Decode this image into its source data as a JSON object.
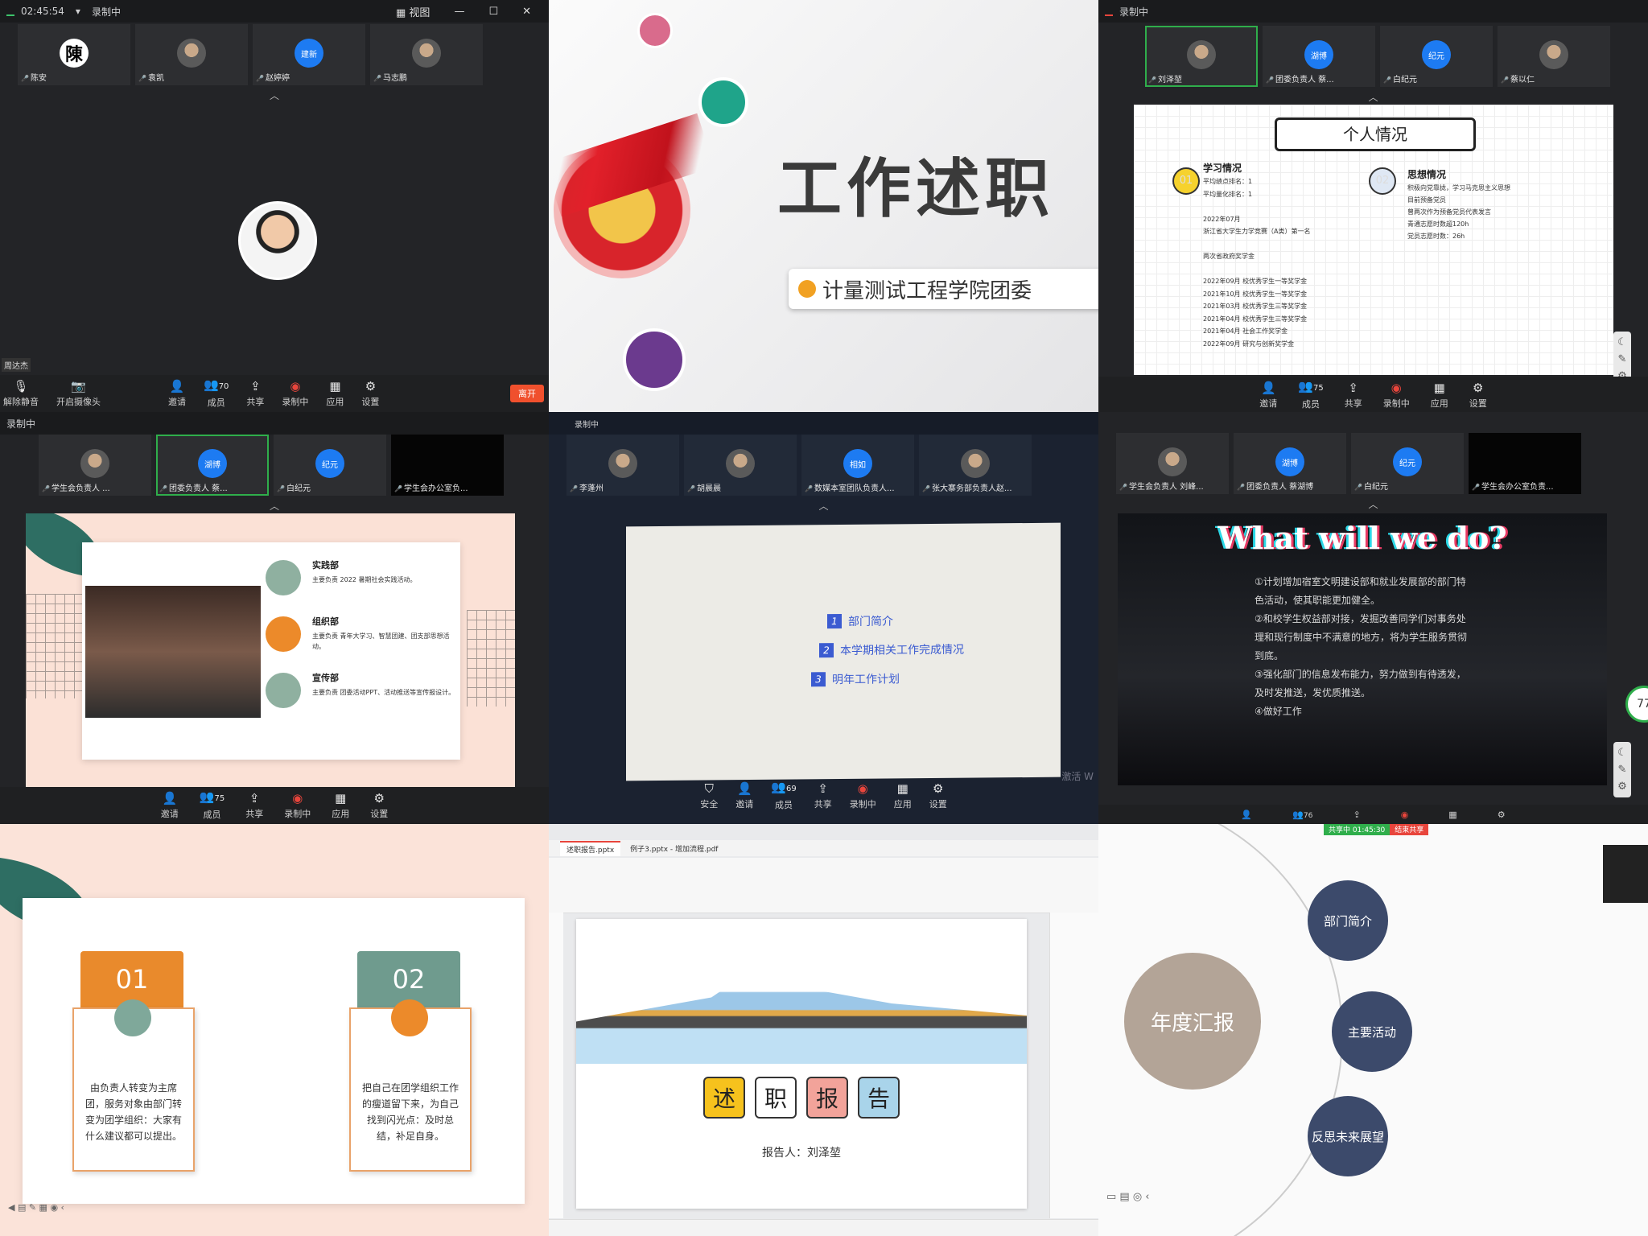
{
  "c1": {
    "time": "02:45:54",
    "rec": "录制中",
    "view": "视图",
    "tiles": [
      "陈安",
      "袁凯",
      "赵婷婷",
      "马志鹏"
    ],
    "tile_avatars": [
      "陳",
      "",
      "建新",
      ""
    ],
    "presenter_label": "周达杰",
    "toolbar": [
      "解除静音",
      "开启摄像头",
      "邀请",
      "成员",
      "共享",
      "录制中",
      "应用",
      "设置"
    ],
    "members_count": "70",
    "leave": "离开"
  },
  "c2": {
    "title": "工作述职",
    "subtitle": "计量测试工程学院团委"
  },
  "c3": {
    "rec": "录制中",
    "tiles": [
      "刘泽堃",
      "团委负责人 蔡...",
      "白纪元",
      "蔡以仁"
    ],
    "tile_avatars": [
      "",
      "湖博",
      "纪元",
      ""
    ],
    "slide_title": "个人情况",
    "s1_num": "01",
    "s1_head": "学习情况",
    "s1_lines": [
      "平均绩点排名：1",
      "平均量化排名：1",
      "",
      "2022年07月",
      "浙江省大学生力学竞赛（A类）第一名",
      "",
      "两次省政府奖学金",
      "",
      "2022年09月  校优秀学生一等奖学金",
      "2021年10月  校优秀学生一等奖学金",
      "2021年03月  校优秀学生三等奖学金",
      "2021年04月  校优秀学生三等奖学金",
      "2021年04月  社会工作奖学金",
      "2022年09月  研究与创新奖学金"
    ],
    "s2_num": "02",
    "s2_head": "思想情况",
    "s2_lines": [
      "积极向党靠拢，学习马克思主义思想",
      "目前预备党员",
      "曾两次作为预备党员代表发言",
      "青通志愿时数超120h",
      "党员志愿时数：26h"
    ],
    "toolbar": [
      "邀请",
      "成员",
      "共享",
      "录制中",
      "应用",
      "设置"
    ],
    "members_count": "75"
  },
  "c4": {
    "rec": "录制中",
    "tiles": [
      "学生会负责人 ...",
      "团委负责人 蔡...",
      "白纪元",
      "学生会办公室负..."
    ],
    "tile_avatars": [
      "",
      "湖博",
      "纪元",
      ""
    ],
    "items": [
      {
        "head": "实践部",
        "body": "主要负责 2022 暑期社会实践活动。"
      },
      {
        "head": "组织部",
        "body": "主要负责 青年大学习、智慧团建、团支部思想活动。"
      },
      {
        "head": "宣传部",
        "body": "主要负责 团委活动PPT、活动推送等宣传报设计。"
      }
    ],
    "toolbar": [
      "邀请",
      "成员",
      "共享",
      "录制中",
      "应用",
      "设置"
    ],
    "members_count": "75"
  },
  "c5": {
    "rec": "录制中",
    "tiles": [
      "李蓬州",
      "胡晨晨",
      "数媒本室团队负责人...",
      "张大寨务部负责人赵..."
    ],
    "tile_avatars": [
      "",
      "",
      "相如",
      ""
    ],
    "agenda": [
      {
        "n": "1",
        "t": "部门简介"
      },
      {
        "n": "2",
        "t": "本学期相关工作完成情况"
      },
      {
        "n": "3",
        "t": "明年工作计划"
      }
    ],
    "watermark": "激活 W",
    "toolbar": [
      "安全",
      "邀请",
      "成员",
      "共享",
      "录制中",
      "应用",
      "设置"
    ],
    "members_count": "69"
  },
  "c6": {
    "tiles": [
      "学生会负责人 刘峰...",
      "团委负责人 蔡湖博",
      "白纪元",
      "学生会办公室负责..."
    ],
    "tile_avatars": [
      "",
      "湖博",
      "纪元",
      ""
    ],
    "title": "What will we do?",
    "lines": [
      "①计划增加宿室文明建设部和就业发展部的部门特色活动，使其职能更加健全。",
      "②和校学生权益部对接，发掘改善同学们对事务处理和现行制度中不满意的地方，将为学生服务贯彻到底。",
      "③强化部门的信息发布能力，努力做到有待透发，及时发推送，发优质推送。",
      "④做好工作"
    ],
    "members_count": "76",
    "badge": "77"
  },
  "c7": {
    "cards": [
      {
        "num": "01",
        "text": "由负责人转变为主席团，服务对象由部门转变为团学组织：大家有什么建议都可以提出。"
      },
      {
        "num": "02",
        "text": "把自己在团学组织工作的瘦道留下来，为自己找到闪光点：及时总结，补足自身。"
      }
    ]
  },
  "c8": {
    "tabs": [
      "述职报告.pptx",
      "例子3.pptx - 增加流程.pdf"
    ],
    "chars": [
      "述",
      "职",
      "报",
      "告"
    ],
    "reporter": "报告人：刘泽堃"
  },
  "c9": {
    "banner_a": "共享中 01:45:30",
    "banner_b": "结束共享",
    "center": "年度汇报",
    "nodes": [
      "部门简介",
      "主要活动",
      "反思未来展望"
    ]
  }
}
